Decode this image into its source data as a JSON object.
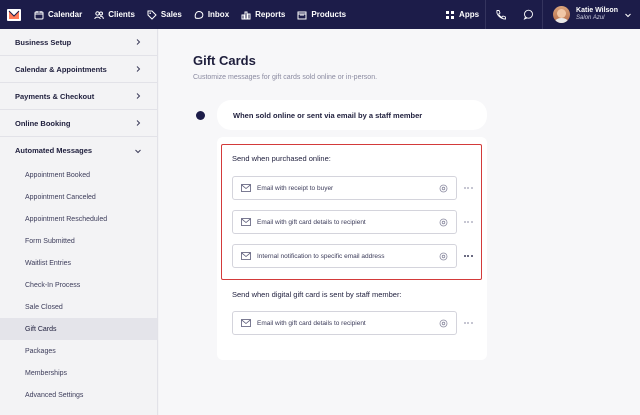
{
  "topnav": {
    "items": [
      {
        "label": "Calendar",
        "icon": "calendar-icon"
      },
      {
        "label": "Clients",
        "icon": "clients-icon"
      },
      {
        "label": "Sales",
        "icon": "sales-tag-icon"
      },
      {
        "label": "Inbox",
        "icon": "inbox-icon"
      },
      {
        "label": "Reports",
        "icon": "reports-chart-icon"
      },
      {
        "label": "Products",
        "icon": "products-box-icon"
      }
    ],
    "apps_label": "Apps",
    "user": {
      "name": "Katie Wilson",
      "business": "Salon Azul"
    },
    "brand_color": "#1c1c49"
  },
  "sidebar": {
    "sections": [
      {
        "label": "Business Setup"
      },
      {
        "label": "Calendar & Appointments"
      },
      {
        "label": "Payments & Checkout"
      },
      {
        "label": "Online Booking"
      },
      {
        "label": "Automated Messages"
      }
    ],
    "sub_items": [
      "Appointment Booked",
      "Appointment Canceled",
      "Appointment Rescheduled",
      "Form Submitted",
      "Waitlist Entries",
      "Check-In Process",
      "Sale Closed",
      "Gift Cards",
      "Packages",
      "Memberships",
      "Advanced Settings"
    ],
    "active_sub": "Gift Cards"
  },
  "main": {
    "title": "Gift Cards",
    "subtitle": "Customize messages for gift cards sold online or in-person.",
    "card_head": "When sold online or sent via email by a staff member",
    "group_online": {
      "label": "Send when purchased online:",
      "rows": [
        "Email with receipt to buyer",
        "Email with gift card details to recipient",
        "Internal notification to specific email address"
      ]
    },
    "group_staff": {
      "label": "Send when digital gift card is sent by staff member:",
      "rows": [
        "Email with gift card details to recipient"
      ]
    },
    "highlight_color": "#d33a3a"
  }
}
